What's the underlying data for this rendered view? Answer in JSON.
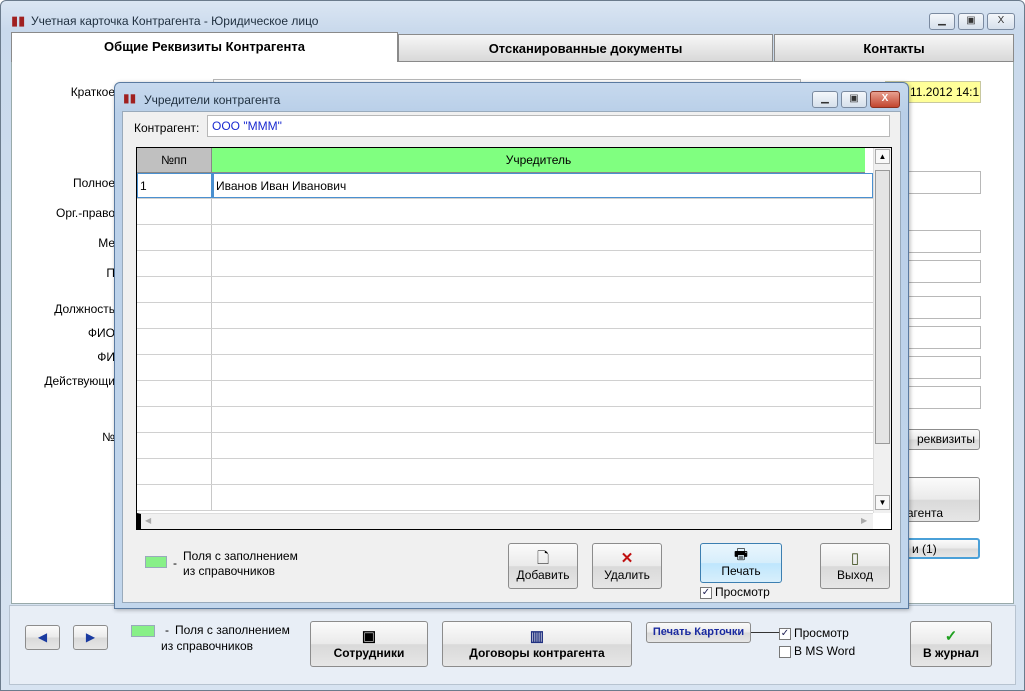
{
  "main": {
    "title": "Учетная карточка Контрагента - Юридическое лицо",
    "tabs": [
      "Общие Реквизиты Контрагента",
      "Отсканированные документы",
      "Контакты"
    ],
    "labels": [
      "Краткое",
      "Полное",
      "Орг.-право",
      "Ме",
      "П",
      "Должность",
      "ФИО",
      "ФИ",
      "Действующи",
      "№"
    ],
    "date_value": "11.2012 14:1",
    "rekvizity_button": "реквизиты",
    "kontragenta_button": "агента",
    "count_button": "и (1)",
    "legend": {
      "dash": "-",
      "line1": "Поля с заполнением",
      "line2": "из справочников"
    },
    "buttons": {
      "employees": "Сотрудники",
      "contracts": "Договоры контрагента",
      "print_card": "Печать Карточки",
      "journal": "В журнал"
    },
    "checks": {
      "preview": "Просмотр",
      "ms_word": "В MS Word"
    },
    "window_controls": {
      "minimize": "_",
      "maximize": "□",
      "close": "X"
    }
  },
  "dialog": {
    "title": "Учредители контрагента",
    "contractor_label": "Контрагент:",
    "contractor_value": "ООО \"МММ\"",
    "grid": {
      "columns": [
        "№пп",
        "Учредитель"
      ],
      "rows": [
        {
          "n": "1",
          "name": "Иванов Иван Иванович"
        }
      ]
    },
    "legend": {
      "dash": "-",
      "line1": "Поля с заполнением",
      "line2": "из справочников"
    },
    "buttons": {
      "add": "Добавить",
      "delete": "Удалить",
      "print": "Печать",
      "exit": "Выход"
    },
    "preview_check": "Просмотр"
  },
  "colors": {
    "lookup_green": "#80ff80",
    "date_yellow": "#ffff99"
  }
}
